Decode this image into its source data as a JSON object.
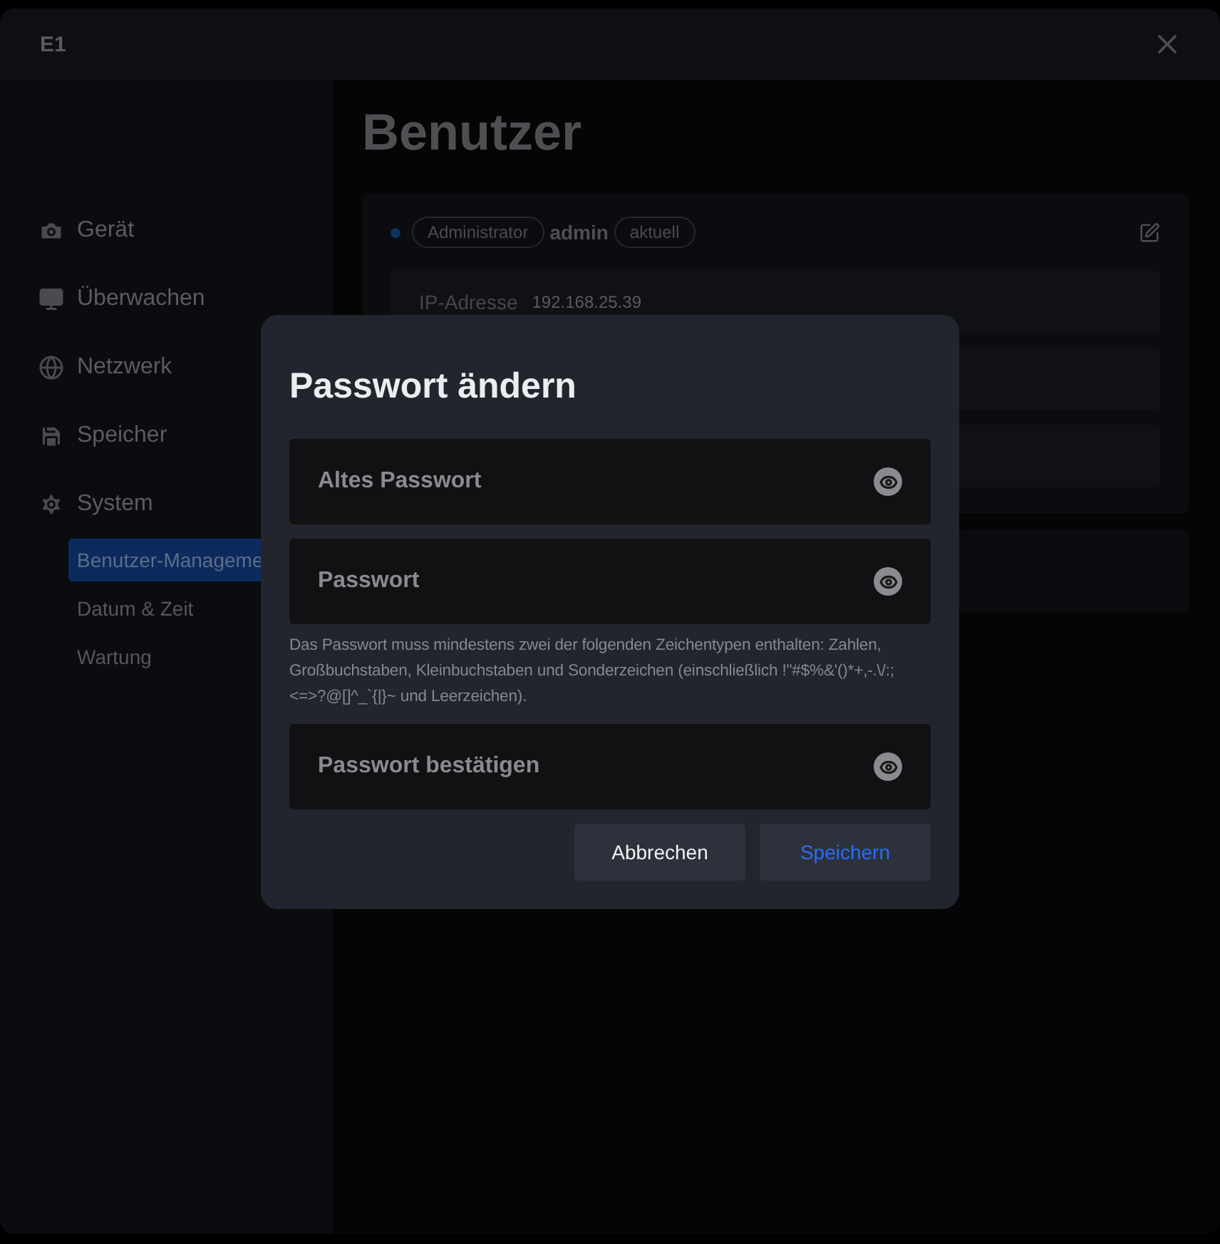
{
  "window": {
    "title": "E1"
  },
  "sidebar": {
    "items": [
      {
        "label": "Gerät",
        "kind": "camera"
      },
      {
        "label": "Überwachen",
        "kind": "monitor"
      },
      {
        "label": "Netzwerk",
        "kind": "globe"
      },
      {
        "label": "Speicher",
        "kind": "storage"
      },
      {
        "label": "System",
        "kind": "gear",
        "children": [
          {
            "label": "Benutzer-Manageme",
            "selected": true
          },
          {
            "label": "Datum & Zeit",
            "selected": false
          },
          {
            "label": "Wartung",
            "selected": false
          }
        ]
      }
    ]
  },
  "page": {
    "title": "Benutzer",
    "user": {
      "role": "Administrator",
      "name": "admin",
      "tag": "aktuell"
    },
    "info": [
      {
        "label": "IP-Adresse",
        "value": "192.168.25.39"
      }
    ]
  },
  "dialog": {
    "title": "Passwort ändern",
    "fields": [
      {
        "placeholder": "Altes Passwort"
      },
      {
        "placeholder": "Passwort",
        "hint": "Das Passwort muss mindestens zwei der folgenden Zeichentypen enthalten: Zahlen, Großbuchstaben, Kleinbuchstaben und Sonderzeichen (einschließlich !\"#$%&'()*+,-.\\/:;<=>?@[]^_`{|}~ und Leerzeichen)."
      },
      {
        "placeholder": "Passwort bestätigen"
      }
    ],
    "buttons": [
      {
        "label": "Abbrechen",
        "kind": "secondary"
      },
      {
        "label": "Speichern",
        "kind": "primary"
      }
    ]
  }
}
